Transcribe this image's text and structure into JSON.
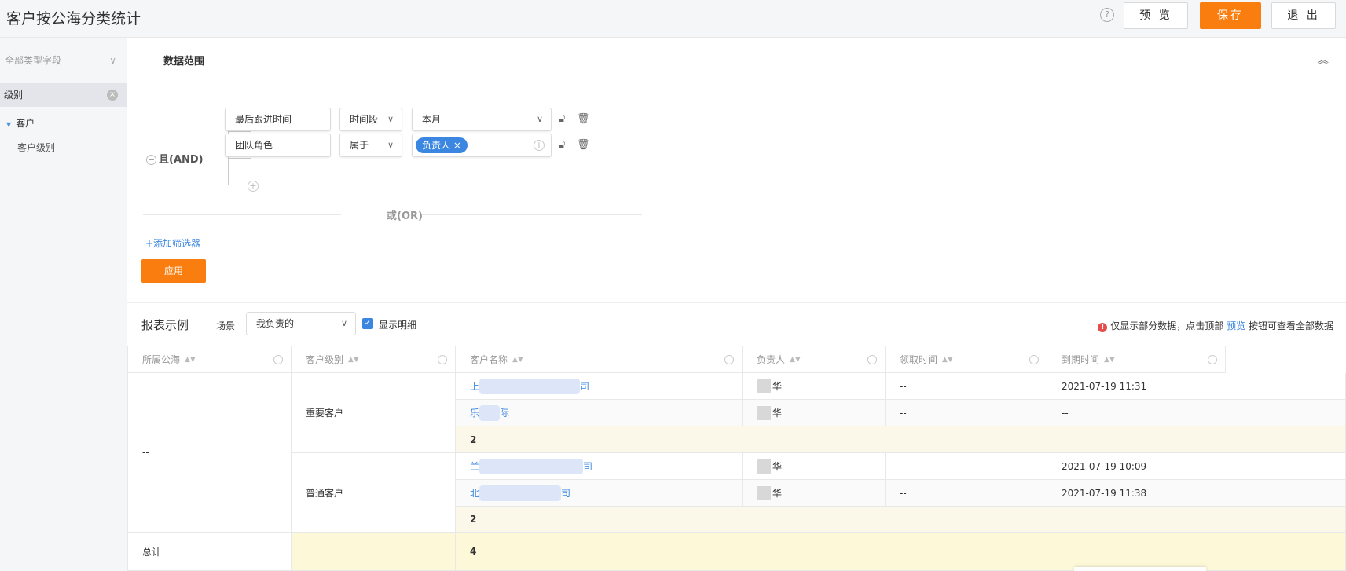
{
  "header": {
    "title": "客户按公海分类统计",
    "help_icon": "?",
    "preview_label": "预 览",
    "save_label": "保存",
    "exit_label": "退 出",
    "accent_color": "#fa7d0f"
  },
  "sidebar": {
    "field_select": "全部类型字段",
    "chip_label": "级别",
    "tree_parent": "客户",
    "tree_child": "客户级别"
  },
  "filter": {
    "section_title": "数据范围",
    "and_label": "且(AND)",
    "or_label": "或(OR)",
    "rows": [
      {
        "field": "最后跟进时间",
        "operator": "时间段",
        "value": "本月"
      },
      {
        "field": "团队角色",
        "operator": "属于",
        "tag": "负责人"
      }
    ],
    "add_filter": "+添加筛选器",
    "apply_label": "应用"
  },
  "report": {
    "title": "报表示例",
    "scene_label": "场景",
    "scene_value": "我负责的",
    "show_detail_label": "显示明细",
    "notice_prefix": "仅显示部分数据，点击顶部",
    "notice_link": "预览",
    "notice_suffix": "按钮可查看全部数据"
  },
  "table": {
    "columns": [
      "所属公海",
      "客户级别",
      "客户名称",
      "负责人",
      "领取时间",
      "到期时间"
    ],
    "group_pool": "--",
    "groups": [
      {
        "level": "重要客户",
        "rows": [
          {
            "name_start": "上",
            "name_end": "司",
            "owner_end": "华",
            "claim_time": "--",
            "expire_time": "2021-07-19 11:31"
          },
          {
            "name_start": "乐",
            "name_end": "际",
            "owner_end": "华",
            "claim_time": "--",
            "expire_time": "--"
          }
        ],
        "subtotal": "2"
      },
      {
        "level": "普通客户",
        "rows": [
          {
            "name_start": "兰",
            "name_end": "司",
            "owner_end": "华",
            "claim_time": "--",
            "expire_time": "2021-07-19 10:09"
          },
          {
            "name_start": "北",
            "name_end": "司",
            "owner_end": "华",
            "claim_time": "--",
            "expire_time": "2021-07-19 11:38"
          }
        ],
        "subtotal": "2"
      }
    ],
    "total_label": "总计",
    "total_value": "4"
  }
}
